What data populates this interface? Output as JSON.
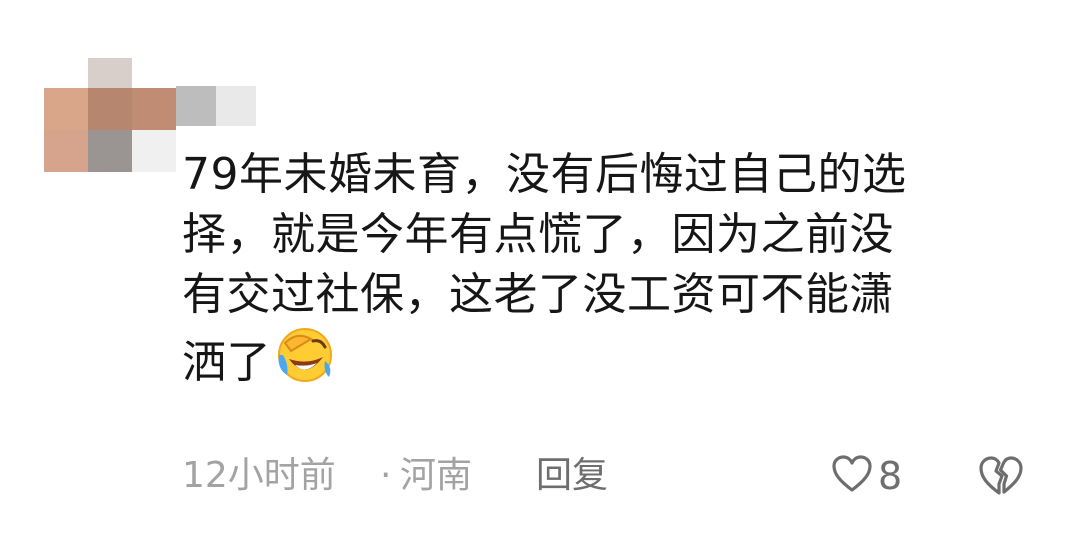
{
  "comment": {
    "lines": [
      "79年未婚未育，没有后悔过自己的选",
      "择，就是今年有点慌了，因为之前没",
      "有交过社保，这老了没工资可不能潇",
      "洒了"
    ],
    "emoji": "laughing-crying-face-icon"
  },
  "meta": {
    "time": "12小时前",
    "separator": "·",
    "location": "河南",
    "reply_label": "回复",
    "like_count": "8"
  },
  "colors": {
    "text": "#161616",
    "meta": "#a3a3a3",
    "action": "#6e6e6e",
    "emoji_face": "#ffcc33"
  }
}
